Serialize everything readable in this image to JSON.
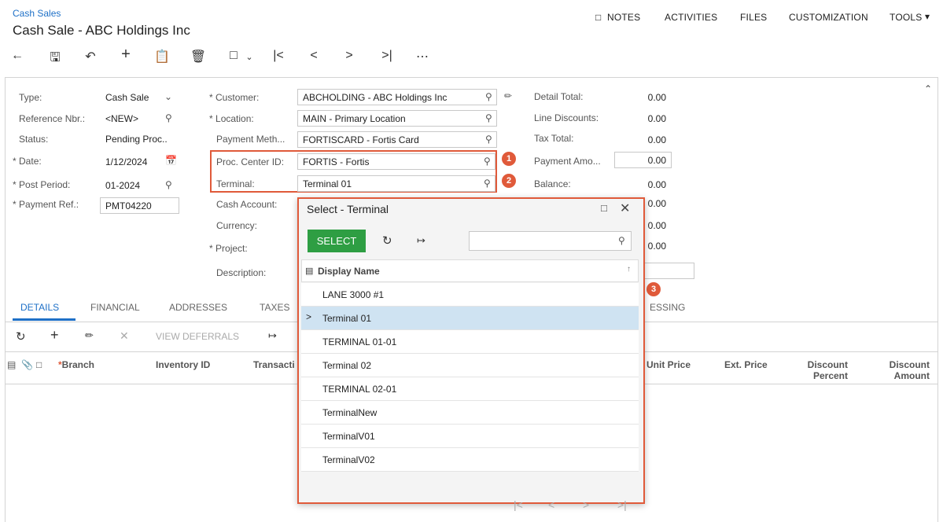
{
  "header": {
    "breadcrumb": "Cash Sales",
    "title": "Cash Sale - ABC Holdings Inc"
  },
  "topmenu": {
    "notes": "NOTES",
    "activities": "ACTIVITIES",
    "files": "FILES",
    "customization": "CUSTOMIZATION",
    "tools": "TOOLS"
  },
  "form": {
    "type_label": "Type:",
    "type_value": "Cash Sale",
    "ref_label": "Reference Nbr.:",
    "ref_value": "<NEW>",
    "status_label": "Status:",
    "status_value": "Pending Proc..",
    "date_label": "Date:",
    "date_value": "1/12/2024",
    "period_label": "Post Period:",
    "period_value": "01-2024",
    "payref_label": "Payment Ref.:",
    "payref_value": "PMT04220",
    "customer_label": "Customer:",
    "customer_value": "ABCHOLDING - ABC Holdings Inc",
    "location_label": "Location:",
    "location_value": "MAIN - Primary Location",
    "paymeth_label": "Payment Meth...",
    "paymeth_value": "FORTISCARD - Fortis Card",
    "proccenter_label": "Proc. Center ID:",
    "proccenter_value": "FORTIS - Fortis",
    "terminal_label": "Terminal:",
    "terminal_value": "Terminal 01",
    "cashacct_label": "Cash Account:",
    "currency_label": "Currency:",
    "project_label": "Project:",
    "description_label": "Description:",
    "detail_total_label": "Detail Total:",
    "detail_total": "0.00",
    "line_disc_label": "Line Discounts:",
    "line_disc": "0.00",
    "tax_total_label": "Tax Total:",
    "tax_total": "0.00",
    "pay_amt_label": "Payment Amo...",
    "pay_amt": "0.00",
    "balance_label": "Balance:",
    "balance": "0.00",
    "extra1": "0.00",
    "extra2": "0.00",
    "extra3": "0.00"
  },
  "tabs": {
    "details": "DETAILS",
    "financial": "FINANCIAL",
    "addresses": "ADDRESSES",
    "taxes": "TAXES",
    "processing": "ESSING"
  },
  "grid_toolbar": {
    "view_deferrals": "VIEW DEFERRALS"
  },
  "grid_headers": {
    "branch": "Branch",
    "inventory": "Inventory ID",
    "transaction": "Transacti",
    "unit_price": "Unit Price",
    "ext_price": "Ext. Price",
    "disc_pct": "Discount Percent",
    "disc_amt": "Discount Amount"
  },
  "dialog": {
    "title": "Select - Terminal",
    "select_label": "SELECT",
    "column": "Display Name",
    "rows": [
      "LANE 3000 #1",
      "Terminal 01",
      "TERMINAL 01-01",
      "Terminal 02",
      "TERMINAL 02-01",
      "TerminalNew",
      "TerminalV01",
      "TerminalV02"
    ]
  },
  "badges": {
    "b1": "1",
    "b2": "2",
    "b3": "3"
  },
  "colors": {
    "accent": "#1e70c7",
    "highlight": "#e05a3a",
    "select_btn": "#2e9e43",
    "selected_row": "#cfe3f2"
  }
}
